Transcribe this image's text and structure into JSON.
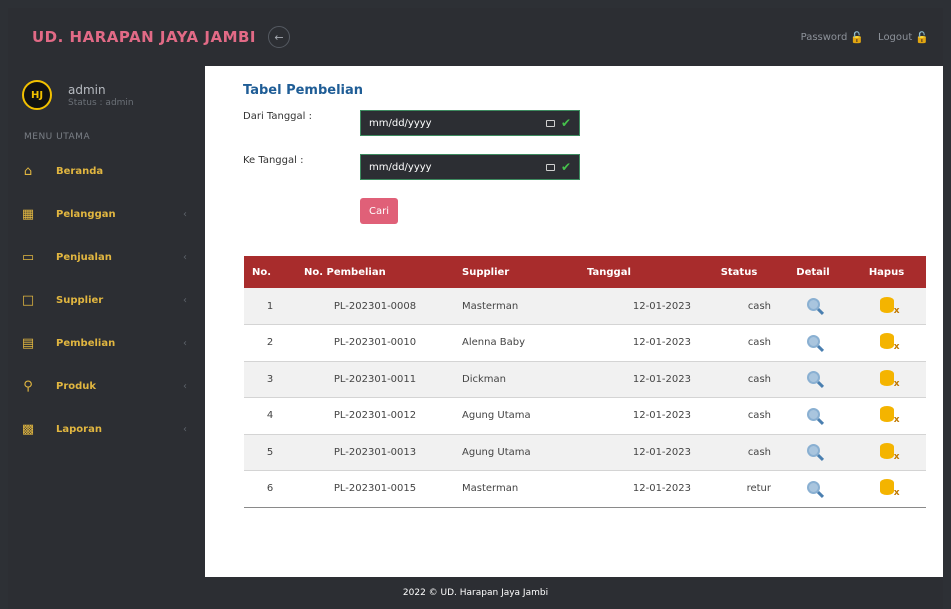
{
  "topbar": {
    "brand": "UD. HARAPAN JAYA JAMBI",
    "toggle_icon": "arrow-left-icon",
    "password_label": "Password",
    "logout_label": "Logout"
  },
  "sidebar": {
    "avatar_text": "HJ",
    "user_name": "admin",
    "user_status": "Status : admin",
    "menu_title": "MENU UTAMA",
    "items": [
      {
        "label": "Beranda",
        "icon": "home-icon"
      },
      {
        "label": "Pelanggan",
        "icon": "grid-icon"
      },
      {
        "label": "Penjualan",
        "icon": "window-icon"
      },
      {
        "label": "Supplier",
        "icon": "monitor-icon"
      },
      {
        "label": "Pembelian",
        "icon": "clipboard-icon"
      },
      {
        "label": "Produk",
        "icon": "award-icon"
      },
      {
        "label": "Laporan",
        "icon": "chart-icon"
      }
    ]
  },
  "main": {
    "title": "Tabel Pembelian",
    "from_label": "Dari Tanggal :",
    "to_label": "Ke Tanggal :",
    "date_placeholder": "mm/dd/yyyy",
    "search_label": "Cari",
    "table": {
      "headers": [
        "No.",
        "No. Pembelian",
        "Supplier",
        "Tanggal",
        "Status",
        "Detail",
        "Hapus"
      ],
      "rows": [
        {
          "no": "1",
          "kode": "PL-202301-0008",
          "supplier": "Masterman",
          "tanggal": "12-01-2023",
          "status": "cash"
        },
        {
          "no": "2",
          "kode": "PL-202301-0010",
          "supplier": "Alenna Baby",
          "tanggal": "12-01-2023",
          "status": "cash"
        },
        {
          "no": "3",
          "kode": "PL-202301-0011",
          "supplier": "Dickman",
          "tanggal": "12-01-2023",
          "status": "cash"
        },
        {
          "no": "4",
          "kode": "PL-202301-0012",
          "supplier": "Agung Utama",
          "tanggal": "12-01-2023",
          "status": "cash"
        },
        {
          "no": "5",
          "kode": "PL-202301-0013",
          "supplier": "Agung Utama",
          "tanggal": "12-01-2023",
          "status": "cash"
        },
        {
          "no": "6",
          "kode": "PL-202301-0015",
          "supplier": "Masterman",
          "tanggal": "12-01-2023",
          "status": "retur"
        }
      ]
    }
  },
  "footer": {
    "text": "2022 © UD. Harapan Jaya Jambi"
  },
  "colors": {
    "accent": "#e1b640",
    "brand": "#e26a86",
    "table_header": "#a82c2c",
    "title": "#1f5d96",
    "button": "#e06078"
  }
}
